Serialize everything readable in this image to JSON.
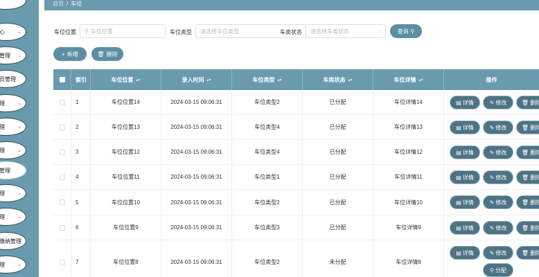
{
  "sidebar": {
    "items": [
      {
        "label": ""
      },
      {
        "label": "心"
      },
      {
        "label": "管理"
      },
      {
        "label": "员管理"
      },
      {
        "label": "理"
      },
      {
        "label": "理"
      },
      {
        "label": "理"
      },
      {
        "label": "管理"
      },
      {
        "label": "理"
      },
      {
        "label": "理"
      },
      {
        "label": "缴纳管理"
      },
      {
        "label": "理"
      }
    ]
  },
  "breadcrumb": {
    "home": "首页",
    "separator": "/",
    "current": "车位"
  },
  "filters": {
    "location_label": "车位位置",
    "location_placeholder": "车位位置",
    "type_label": "车位类型",
    "type_placeholder": "请选择车位类型",
    "status_label": "车类状态",
    "status_placeholder": "请选择车类状态",
    "search_button": "查询"
  },
  "toolbar": {
    "add_button": "新增",
    "delete_button": "删除"
  },
  "table": {
    "headers": {
      "index": "索引",
      "location": "车位位置",
      "time": "录入时间",
      "type": "车位类型",
      "status": "车类状态",
      "detail": "车位详情",
      "actions": "操作"
    },
    "action_labels": {
      "detail": "详情",
      "edit": "修改",
      "delete": "删除",
      "assign": "分配"
    },
    "rows": [
      {
        "index": "1",
        "location": "车位位置14",
        "time": "2024-03-15 09:06:31",
        "type": "车位类型2",
        "status": "已分配",
        "detail": "车位详情14"
      },
      {
        "index": "2",
        "location": "车位位置13",
        "time": "2024-03-15 09:06:31",
        "type": "车位类型4",
        "status": "已分配",
        "detail": "车位详情13"
      },
      {
        "index": "3",
        "location": "车位位置12",
        "time": "2024-03-15 09:06:31",
        "type": "车位类型4",
        "status": "已分配",
        "detail": "车位详情12"
      },
      {
        "index": "4",
        "location": "车位位置11",
        "time": "2024-03-15 09:06:31",
        "type": "车位类型1",
        "status": "已分配",
        "detail": "车位详情11"
      },
      {
        "index": "5",
        "location": "车位位置10",
        "time": "2024-03-15 09:06:31",
        "type": "车位类型2",
        "status": "已分配",
        "detail": "车位详情10"
      },
      {
        "index": "6",
        "location": "车位位置9",
        "time": "2024-03-15 09:06:31",
        "type": "车位类型3",
        "status": "已分配",
        "detail": "车位详情9"
      },
      {
        "index": "7",
        "location": "车位位置8",
        "time": "2024-03-15 09:06:31",
        "type": "车位类型2",
        "status": "未分配",
        "detail": "车位详情8"
      }
    ]
  },
  "colors": {
    "primary": "#6a9aad",
    "button": "#5d8fa3",
    "action": "#4e7384"
  }
}
